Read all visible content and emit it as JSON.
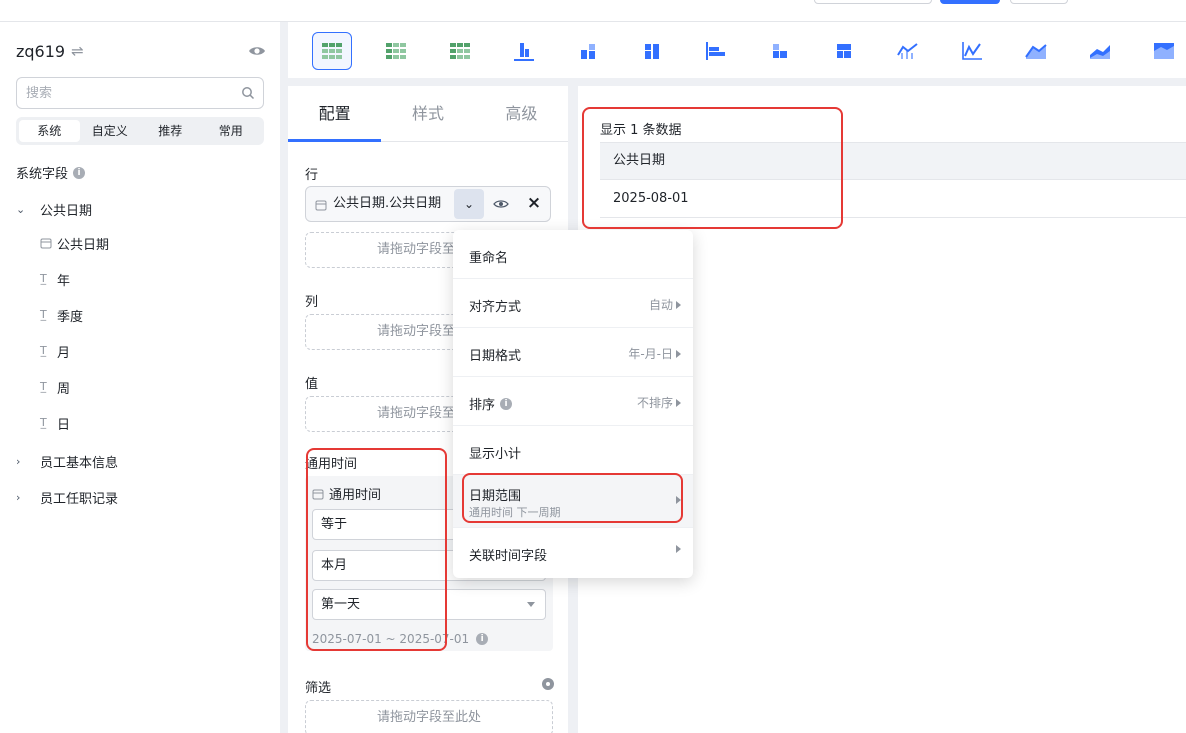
{
  "sidebar": {
    "datasource_name": "zq619",
    "search_placeholder": "搜索",
    "segments": [
      {
        "label": "系统",
        "active": true
      },
      {
        "label": "自定义",
        "active": false
      },
      {
        "label": "推荐",
        "active": false
      },
      {
        "label": "常用",
        "active": false
      }
    ],
    "section_title": "系统字段",
    "tree": {
      "group1": "公共日期",
      "leaves": [
        "公共日期",
        "年",
        "季度",
        "月",
        "周",
        "日"
      ],
      "group2": "员工基本信息",
      "group3": "员工任职记录"
    }
  },
  "toolbar": {
    "chart_type_icons": [
      "table-icon",
      "cross-table-icon",
      "matrix-table-icon",
      "column-chart-icon",
      "stacked-column-icon",
      "grouped-column-icon",
      "bar-chart-icon",
      "stacked-bar-icon",
      "grouped-bar-icon",
      "line-column-combo-icon",
      "line-chart-icon",
      "area-chart-icon",
      "stacked-area-icon",
      "percent-area-icon"
    ],
    "selected_index": 0
  },
  "config": {
    "tabs": [
      {
        "label": "配置",
        "active": true
      },
      {
        "label": "样式",
        "active": false
      },
      {
        "label": "高级",
        "active": false
      }
    ],
    "row_label": "行",
    "row_field": "公共日期.公共日期",
    "drop_hint": "请拖动字段至此处",
    "col_label": "列",
    "value_label": "值",
    "time": {
      "title": "通用时间",
      "field": "通用时间",
      "operator": "等于",
      "period": "本月",
      "anchor": "第一天",
      "range": "2025-07-01 ~ 2025-07-01"
    },
    "filter_label": "筛选"
  },
  "menu": {
    "items": [
      {
        "label": "重命名",
        "value": ""
      },
      {
        "label": "对齐方式",
        "value": "自动"
      },
      {
        "label": "日期格式",
        "value": "年-月-日"
      },
      {
        "label": "排序",
        "value": "不排序"
      },
      {
        "label": "显示小计",
        "value": ""
      },
      {
        "label": "日期范围",
        "sub": "通用时间 下一周期"
      },
      {
        "label": "关联时间字段",
        "value": ""
      }
    ]
  },
  "preview": {
    "count_text": "显示 1 条数据",
    "column_header": "公共日期",
    "rows": [
      "2025-08-01"
    ]
  },
  "colors": {
    "accent": "#3370ff",
    "annotation": "#e53935",
    "chart_icon_blue": "#3370ff",
    "chart_icon_green": "#52a26b"
  }
}
